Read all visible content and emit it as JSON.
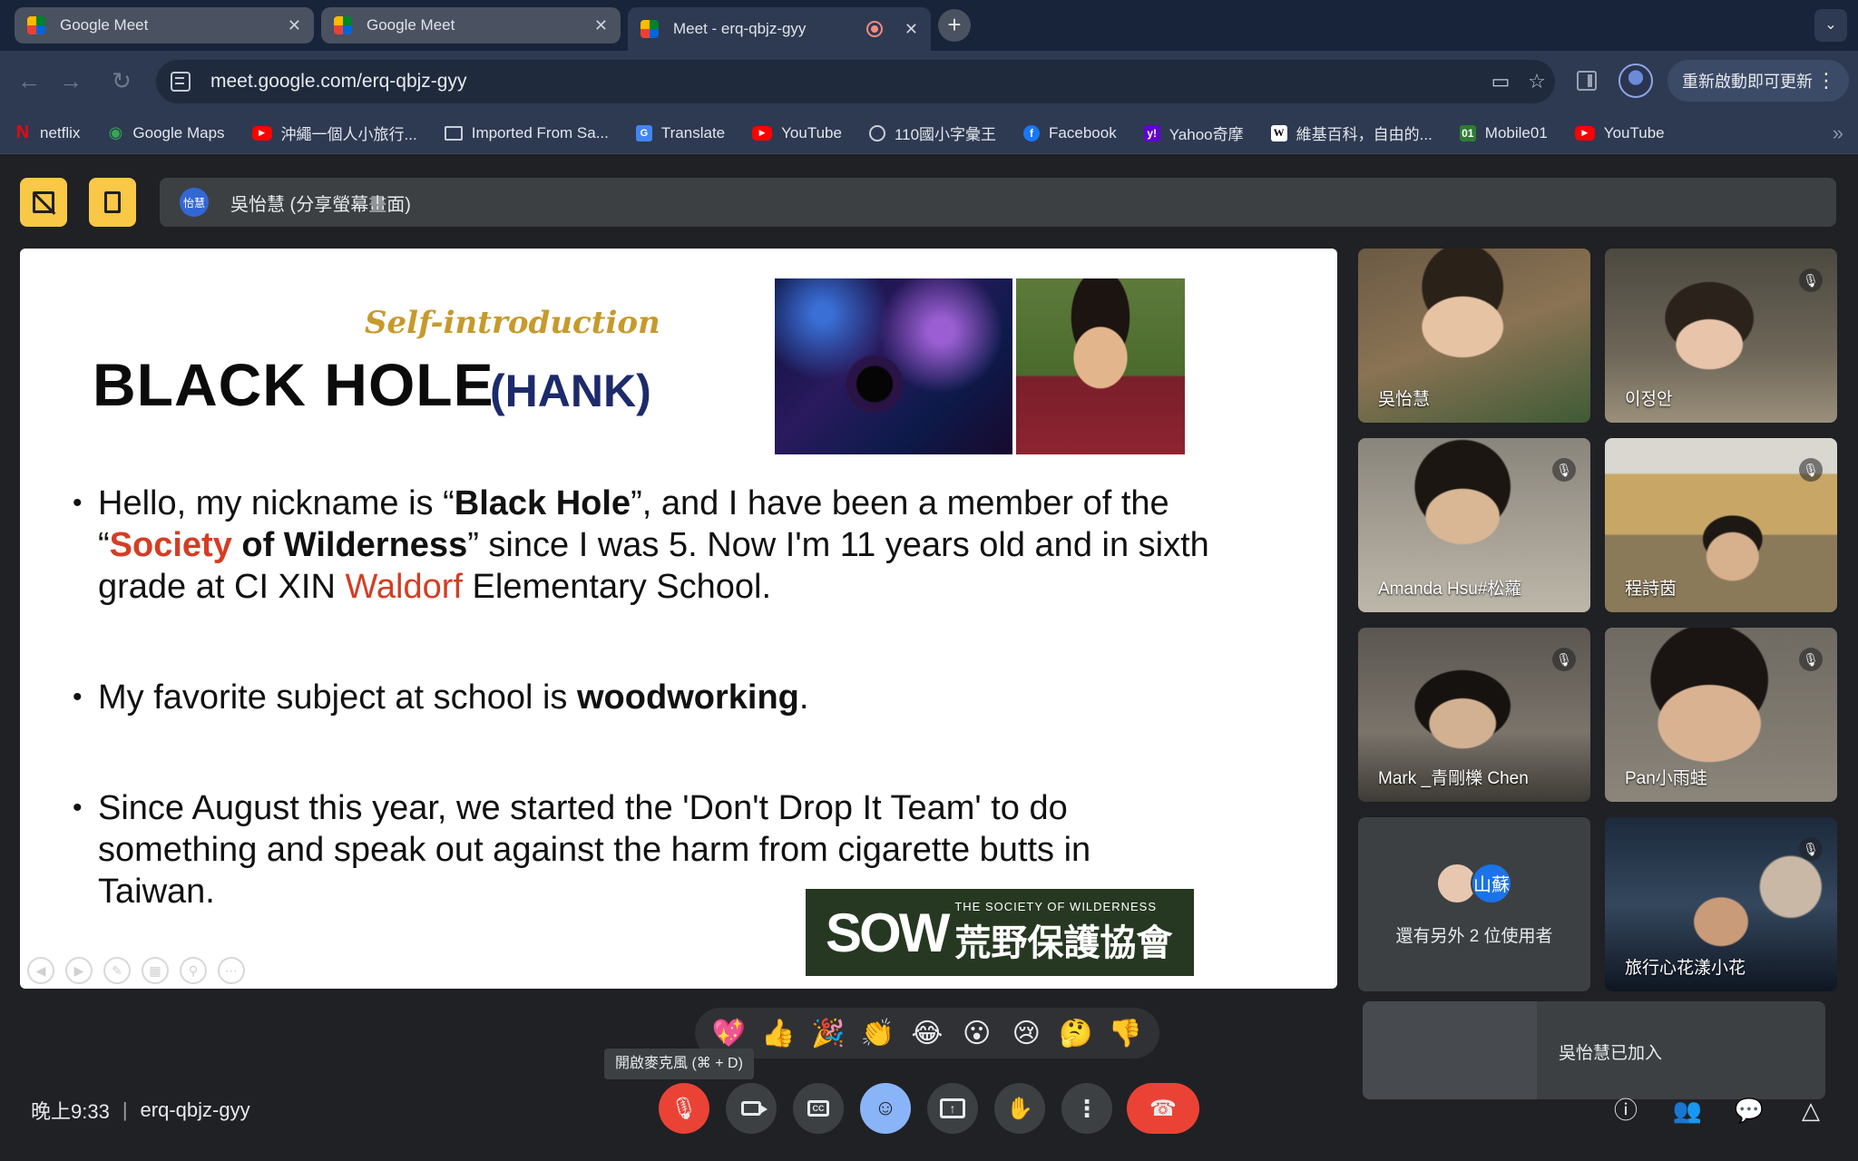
{
  "tabs": [
    {
      "title": "Google Meet",
      "state": "inactive"
    },
    {
      "title": "Google Meet",
      "state": "inactive"
    },
    {
      "title": "Meet - erq-qbjz-gyy",
      "state": "active"
    }
  ],
  "toolbar": {
    "url": "meet.google.com/erq-qbjz-gyy",
    "update_label": "重新啟動即可更新"
  },
  "bookmarks": [
    {
      "label": "netflix",
      "icon": "netflix-icon"
    },
    {
      "label": "Google Maps",
      "icon": "maps-pin-icon"
    },
    {
      "label": "沖繩一個人小旅行...",
      "icon": "youtube-icon"
    },
    {
      "label": "Imported From Sa...",
      "icon": "folder-icon"
    },
    {
      "label": "Translate",
      "icon": "translate-icon"
    },
    {
      "label": "YouTube",
      "icon": "youtube-icon"
    },
    {
      "label": "110國小字彙王",
      "icon": "globe-icon"
    },
    {
      "label": "Facebook",
      "icon": "facebook-icon"
    },
    {
      "label": "Yahoo奇摩",
      "icon": "yahoo-icon"
    },
    {
      "label": "維基百科，自由的...",
      "icon": "wikipedia-icon"
    },
    {
      "label": "Mobile01",
      "icon": "mobile01-icon"
    },
    {
      "label": "YouTube",
      "icon": "youtube-icon"
    }
  ],
  "presentation": {
    "presenter_avatar": "怡慧",
    "banner_text": "吳怡慧 (分享螢幕畫面)"
  },
  "slide": {
    "subtitle": "Self-introduction",
    "heading": "BLACK HOLE",
    "heading_paren": "(HANK)",
    "b1": {
      "t1": "Hello, my nickname is “",
      "t2": "Black Hole",
      "t3": "”, and I have been a member of  the “",
      "t4": "Society",
      "t5": " of Wilderness",
      "t6": "” since I was 5. Now I'm 11 years old and in sixth grade at CI XIN ",
      "t7": "Waldorf",
      "t8": " Elementary School."
    },
    "b2": {
      "t1": "My favorite subject at school is ",
      "t2": "woodworking",
      "t3": "."
    },
    "b3": {
      "t1": "Since August this year, we started the 'Don't Drop It Team' to do something and speak out against the harm from cigarette butts in Taiwan."
    },
    "logo": {
      "mark": "SOW",
      "small": "THE SOCIETY OF WILDERNESS",
      "big": "荒野保護協會"
    }
  },
  "participants": [
    {
      "name": "吳怡慧",
      "muted": false
    },
    {
      "name": "이정안",
      "muted": true
    },
    {
      "name": "Amanda Hsu#松蘿",
      "muted": true
    },
    {
      "name": "程詩茵",
      "muted": true
    },
    {
      "name": "Mark _青剛櫟 Chen",
      "muted": true
    },
    {
      "name": "Pan小雨蛙",
      "muted": true
    },
    {
      "name": "旅行心花漾小花",
      "muted": true
    }
  ],
  "others": {
    "avatar_letter": "山蘇",
    "text": "還有另外 2 位使用者"
  },
  "toast": {
    "text": "吳怡慧已加入"
  },
  "reactions": [
    "💖",
    "👍",
    "🎉",
    "👏",
    "😂",
    "😮",
    "😢",
    "🤔",
    "👎"
  ],
  "tooltip": "開啟麥克風 (⌘ + D)",
  "footer": {
    "time": "晚上9:33",
    "separator": "|",
    "meeting_code": "erq-qbjz-gyy"
  },
  "colors": {
    "accent_yellow": "#f9c846",
    "end_call_red": "#ea4335",
    "active_blue": "#8ab4f8",
    "slide_red": "#d43d24",
    "slide_navy": "#1d2a6b",
    "slide_gold": "#c69a2c"
  }
}
